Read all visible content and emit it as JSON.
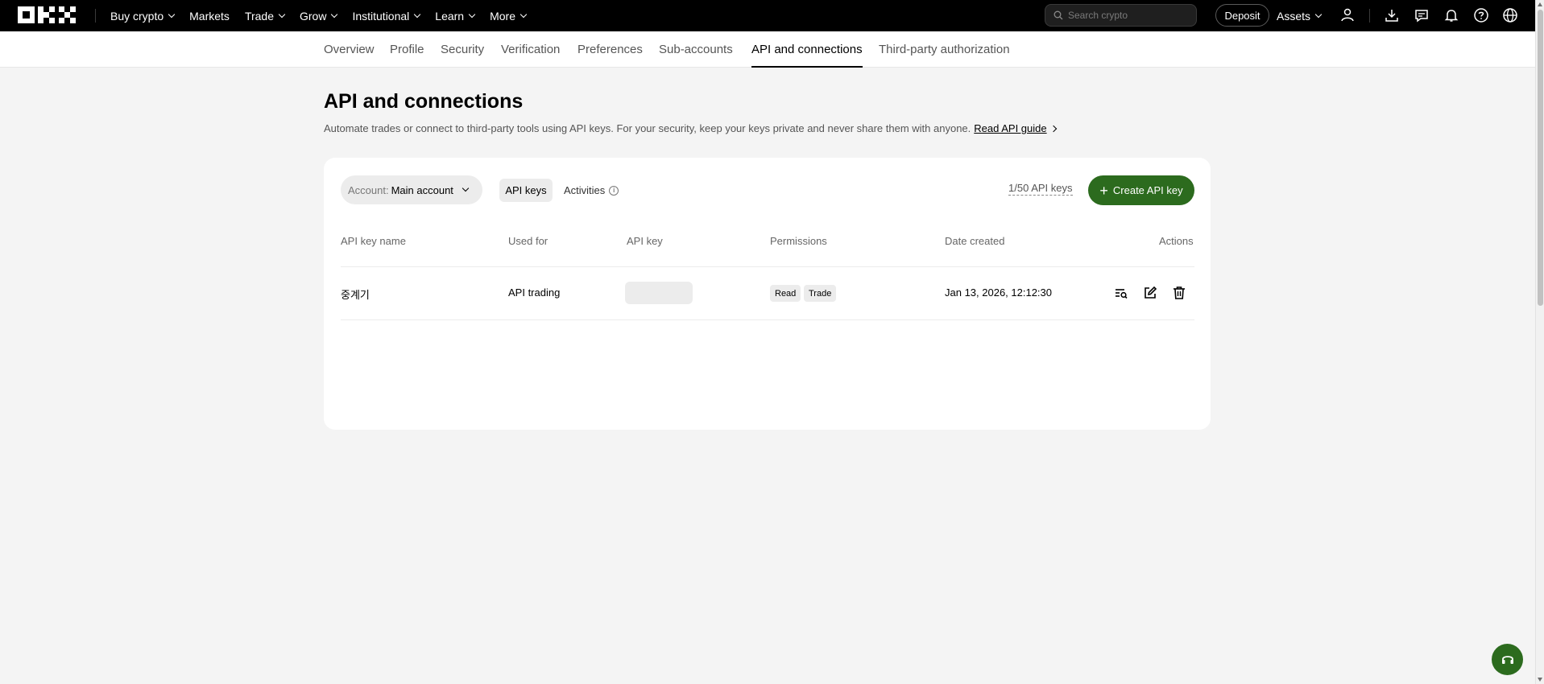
{
  "topnav": {
    "brand": "OKX",
    "items": [
      {
        "label": "Buy crypto",
        "dropdown": true
      },
      {
        "label": "Markets",
        "dropdown": false
      },
      {
        "label": "Trade",
        "dropdown": true
      },
      {
        "label": "Grow",
        "dropdown": true
      },
      {
        "label": "Institutional",
        "dropdown": true
      },
      {
        "label": "Learn",
        "dropdown": true
      },
      {
        "label": "More",
        "dropdown": true
      }
    ],
    "search_placeholder": "Search crypto",
    "deposit_label": "Deposit",
    "assets_label": "Assets",
    "icons": [
      "user-icon",
      "download-icon",
      "message-icon",
      "bell-icon",
      "help-icon",
      "globe-icon"
    ]
  },
  "subtabs": {
    "items": [
      "Overview",
      "Profile",
      "Security",
      "Verification",
      "Preferences",
      "Sub-accounts",
      "API and connections",
      "Third-party authorization"
    ],
    "active": "API and connections"
  },
  "page": {
    "title": "API and connections",
    "description": "Automate trades or connect to third-party tools using API keys. For your security, keep your keys private and never share them with anyone.",
    "guide_link": "Read API guide"
  },
  "card": {
    "account_label": "Account:",
    "account_value": "Main account",
    "tab_api_keys": "API keys",
    "tab_activities": "Activities",
    "key_count": "1/50 API keys",
    "create_button": "Create API key",
    "columns": [
      "API key name",
      "Used for",
      "API key",
      "Permissions",
      "Date created",
      "Actions"
    ],
    "rows": [
      {
        "name": "중계기",
        "used_for": "API trading",
        "api_key": "",
        "permissions": [
          "Read",
          "Trade"
        ],
        "date_created": "Jan 13, 2026, 12:12:30"
      }
    ]
  },
  "colors": {
    "accent_green": "#2c6b1e",
    "topbar_bg": "#000000",
    "page_bg": "#f4f4f4"
  }
}
